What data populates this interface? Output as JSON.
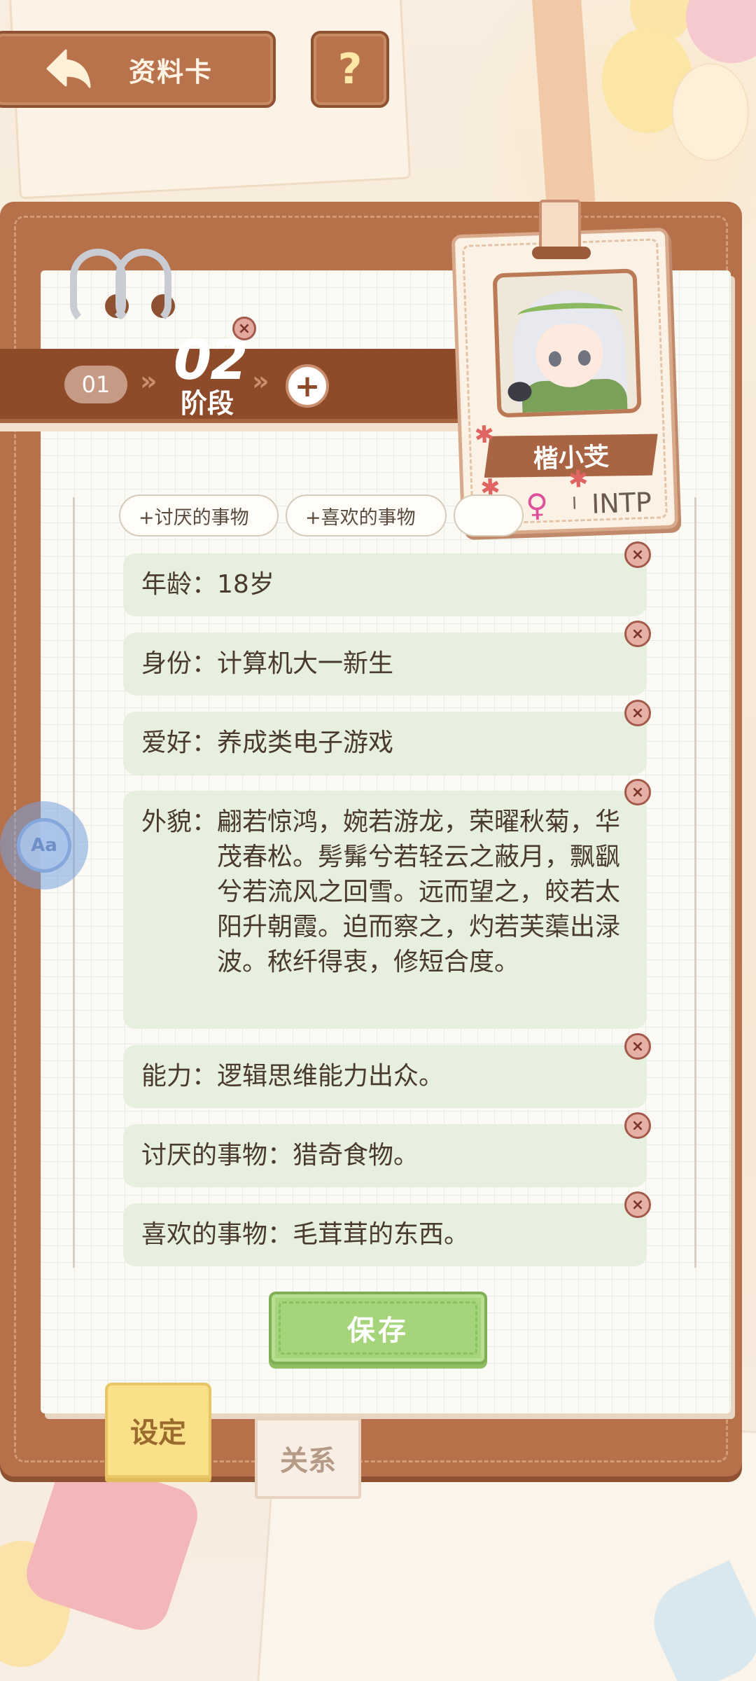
{
  "header": {
    "back_label": "资料卡",
    "help_label": "?"
  },
  "stage": {
    "prev": "01",
    "current_number": "02",
    "current_label": "阶段",
    "add": "+",
    "remove": "×"
  },
  "profile": {
    "name": "楷小芠",
    "gender_symbol": "♀",
    "separator": "I",
    "mbti": "INTP"
  },
  "chips": [
    "+讨厌的事物",
    "+喜欢的事物",
    ""
  ],
  "fields": [
    {
      "key": "年龄：",
      "value": "18岁"
    },
    {
      "key": "身份：",
      "value": "计算机大一新生"
    },
    {
      "key": "爱好：",
      "value": "养成类电子游戏"
    },
    {
      "key": "外貌：",
      "value": "翩若惊鸿，婉若游龙，荣曜秋菊，华茂春松。髣髴兮若轻云之蔽月，飘飖兮若流风之回雪。远而望之，皎若太阳升朝霞。迫而察之，灼若芙蕖出渌波。秾纤得衷，修短合度。"
    },
    {
      "key": "能力：",
      "value": "逻辑思维能力出众。"
    },
    {
      "key": "讨厌的事物：",
      "value": "猎奇食物。"
    },
    {
      "key": "喜欢的事物：",
      "value": "毛茸茸的东西。"
    }
  ],
  "delete_glyph": "×",
  "save_label": "保存",
  "tabs": {
    "settings": "设定",
    "relations": "关系"
  },
  "floating_button": "Aa",
  "colors": {
    "board": "#b6714b",
    "field_bg": "#e7efde",
    "save_bg": "#a5d47a",
    "tab_active": "#fbe08a"
  }
}
